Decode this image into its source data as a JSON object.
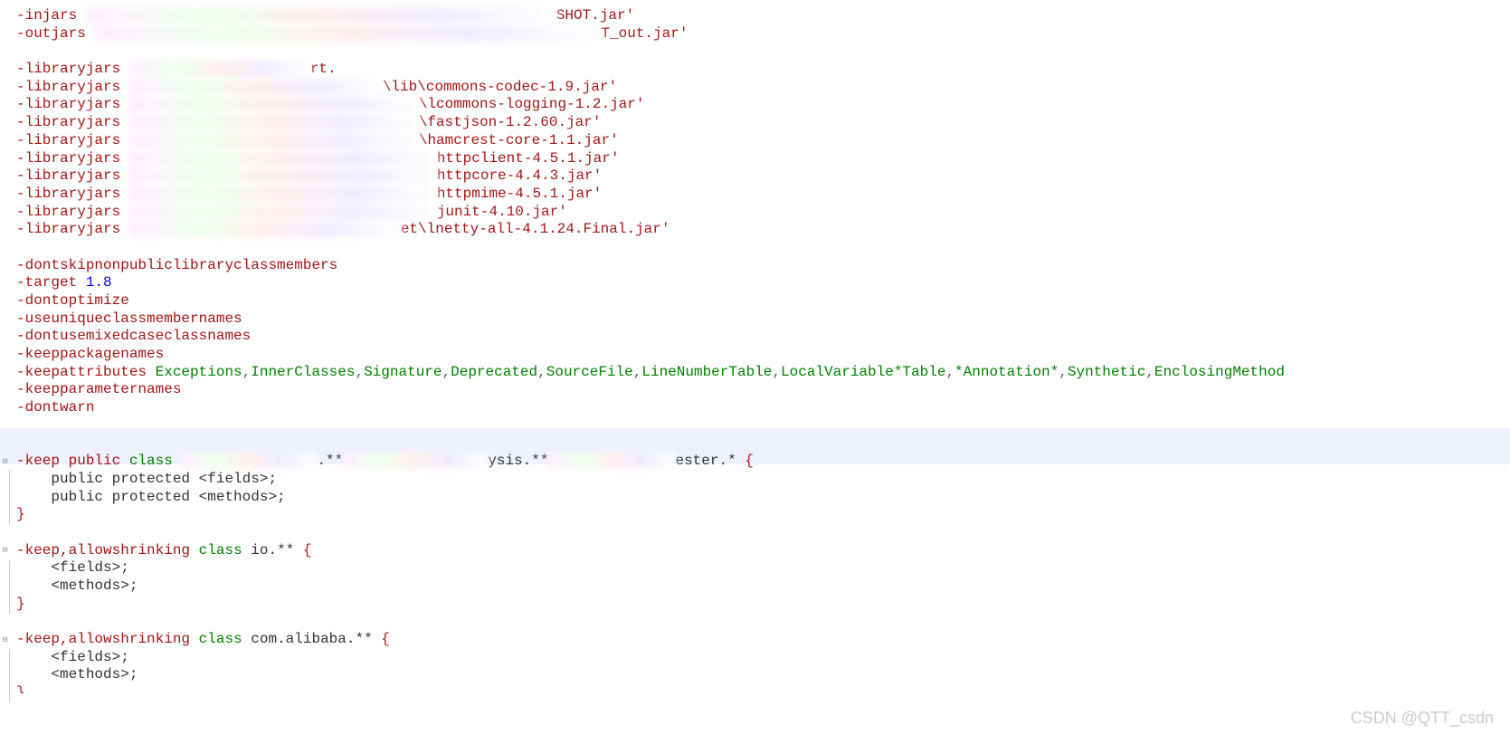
{
  "lines": [
    {
      "t": "injars",
      "tail": "SHOT.jar'",
      "blurW": 520
    },
    {
      "t": "outjars",
      "tail": "T_out.jar'",
      "blurW": 560
    },
    {
      "t": "blank"
    },
    {
      "t": "lib",
      "tail": "rt.",
      "blurW": 200
    },
    {
      "t": "lib",
      "mid": "\\lib\\",
      "tail": "commons-codec-1.9.jar'",
      "blurW": 280
    },
    {
      "t": "lib",
      "mid": "\\l",
      "tail": "commons-logging-1.2.jar'",
      "blurW": 320
    },
    {
      "t": "lib",
      "mid": "\\",
      "tail": "fastjson-1.2.60.jar'",
      "blurW": 320
    },
    {
      "t": "lib",
      "mid": "\\",
      "tail": "hamcrest-core-1.1.jar'",
      "blurW": 320
    },
    {
      "t": "lib",
      "tail": "httpclient-4.5.1.jar'",
      "blurW": 340
    },
    {
      "t": "lib",
      "tail": "httpcore-4.4.3.jar'",
      "blurW": 340
    },
    {
      "t": "lib",
      "tail": "httpmime-4.5.1.jar'",
      "blurW": 340
    },
    {
      "t": "lib",
      "tail": "junit-4.10.jar'",
      "blurW": 340
    },
    {
      "t": "lib",
      "mid": "et\\l",
      "tail": "netty-all-4.1.24.Final.jar'",
      "blurW": 300
    },
    {
      "t": "blank"
    },
    {
      "t": "dir",
      "txt": "-dontskipnonpubliclibraryclassmembers"
    },
    {
      "t": "target",
      "label": "-target",
      "val": "1.8"
    },
    {
      "t": "dir",
      "txt": "-dontoptimize"
    },
    {
      "t": "dir",
      "txt": "-useuniqueclassmembernames"
    },
    {
      "t": "dir",
      "txt": "-dontusemixedcaseclassnames"
    },
    {
      "t": "dir",
      "txt": "-keeppackagenames"
    },
    {
      "t": "attrs",
      "label": "-keepattributes",
      "list": [
        "Exceptions",
        "InnerClasses",
        "Signature",
        "Deprecated",
        "SourceFile",
        "LineNumberTable",
        "LocalVariable*Table",
        "*Annotation*",
        "Synthetic",
        "EnclosingMethod"
      ]
    },
    {
      "t": "dir",
      "txt": "-keepparameternames"
    },
    {
      "t": "dir",
      "txt": "-dontwarn"
    },
    {
      "t": "blank"
    },
    {
      "t": "blankhl"
    },
    {
      "t": "keep1",
      "pre": "-keep public ",
      "cls": "class",
      "mids": [
        ".**",
        "ysis.**",
        "ester.*"
      ],
      "brace": " {"
    },
    {
      "t": "body",
      "txt": "    public protected <fields>;"
    },
    {
      "t": "body",
      "txt": "    public protected <methods>;"
    },
    {
      "t": "close"
    },
    {
      "t": "blank"
    },
    {
      "t": "keep2",
      "pre": "-keep,allowshrinking ",
      "cls": "class",
      "pkg": " io.** ",
      "brace": "{"
    },
    {
      "t": "body",
      "txt": "    <fields>;"
    },
    {
      "t": "body",
      "txt": "    <methods>;"
    },
    {
      "t": "close"
    },
    {
      "t": "blank"
    },
    {
      "t": "keep2",
      "pre": "-keep,allowshrinking ",
      "cls": "class",
      "pkg": " com.alibaba.** ",
      "brace": "{"
    },
    {
      "t": "body",
      "txt": "    <fields>;"
    },
    {
      "t": "body",
      "txt": "    <methods>;"
    },
    {
      "t": "partial"
    }
  ],
  "watermark": "CSDN @QTT_csdn",
  "foldMarks": [
    25,
    30,
    35
  ],
  "braceBars": [
    [
      26,
      28
    ],
    [
      31,
      33
    ],
    [
      36,
      38
    ]
  ]
}
